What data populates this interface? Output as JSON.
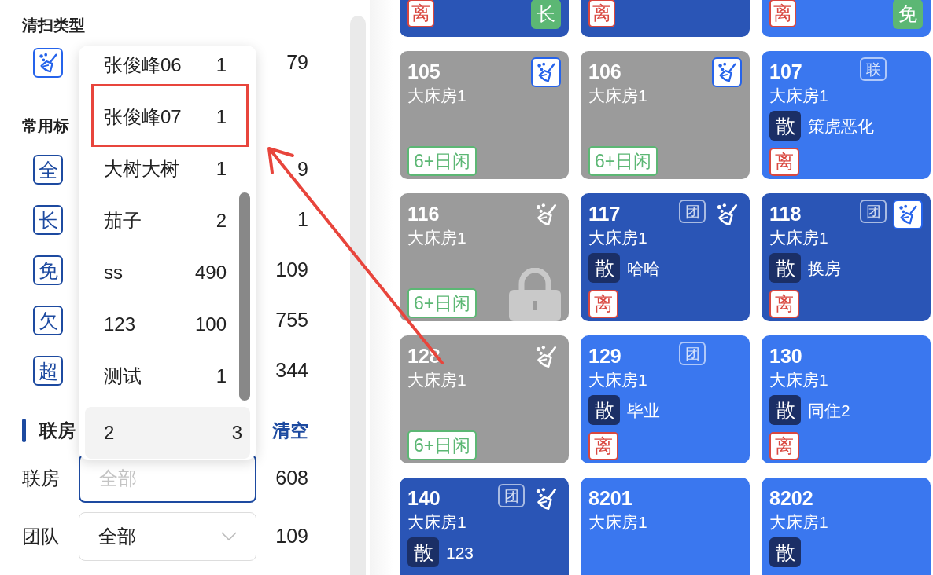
{
  "clean_type": {
    "title": "清扫类型",
    "rows": [
      {
        "count": "79"
      }
    ]
  },
  "common_tags": {
    "title": "常用标",
    "rows": [
      {
        "badge": "全",
        "count": "9"
      },
      {
        "badge": "长",
        "count": "1"
      },
      {
        "badge": "免",
        "count": "109"
      },
      {
        "badge": "欠",
        "count": "755"
      },
      {
        "badge": "超",
        "count": "344"
      }
    ]
  },
  "linked": {
    "title": "联房",
    "clear": "清空",
    "fields": [
      {
        "kind": "input",
        "label": "联房",
        "placeholder": "全部",
        "focused": true,
        "count": "608"
      },
      {
        "kind": "select",
        "label": "团队",
        "value": "全部",
        "focused": false,
        "count": "109"
      }
    ]
  },
  "dropdown": {
    "items": [
      {
        "name": "张俊峰06",
        "count": "1",
        "selected": false,
        "annotated": false
      },
      {
        "name": "张俊峰07",
        "count": "1",
        "selected": false,
        "annotated": true
      },
      {
        "name": "大树大树",
        "count": "1",
        "selected": false,
        "annotated": false
      },
      {
        "name": "茄子",
        "count": "2",
        "selected": false,
        "annotated": false
      },
      {
        "name": "ss",
        "count": "490",
        "selected": false,
        "annotated": false
      },
      {
        "name": "123",
        "count": "100",
        "selected": false,
        "annotated": false
      },
      {
        "name": "测试",
        "count": "1",
        "selected": false,
        "annotated": false
      },
      {
        "name": "2",
        "count": "3",
        "selected": true,
        "annotated": false
      }
    ]
  },
  "rooms": [
    {
      "kind": "partial",
      "color": "#2a55b6",
      "leave": "离",
      "corner": "长"
    },
    {
      "kind": "partial",
      "color": "#2a55b6",
      "leave": "离"
    },
    {
      "kind": "partial",
      "color": "#3a77ef",
      "leave": "离",
      "corner": "免"
    },
    {
      "kind": "full",
      "number": "105",
      "type": "大床房1",
      "color": "#9b9b9b",
      "needs_cleaning": true,
      "clean_boxed": true,
      "idle": "6+日闲",
      "locked": false
    },
    {
      "kind": "full",
      "number": "106",
      "type": "大床房1",
      "color": "#9b9b9b",
      "needs_cleaning": true,
      "clean_boxed": true,
      "idle": "6+日闲",
      "locked": false
    },
    {
      "kind": "full",
      "number": "107",
      "type": "大床房1",
      "color": "#3a77ef",
      "tag": "联",
      "needs_cleaning": false,
      "guest": {
        "badge": "散",
        "name": "策虎恶化"
      },
      "leave": "离",
      "locked": false
    },
    {
      "kind": "full",
      "number": "116",
      "type": "大床房1",
      "color": "#9b9b9b",
      "needs_cleaning": true,
      "clean_boxed": false,
      "idle": "6+日闲",
      "locked": true
    },
    {
      "kind": "full",
      "number": "117",
      "type": "大床房1",
      "color": "#2a55b6",
      "tag": "团",
      "needs_cleaning": true,
      "clean_boxed": false,
      "guest": {
        "badge": "散",
        "name": "哈哈"
      },
      "leave": "离",
      "locked": false
    },
    {
      "kind": "full",
      "number": "118",
      "type": "大床房1",
      "color": "#2a55b6",
      "tag": "团",
      "needs_cleaning": true,
      "clean_boxed": true,
      "guest": {
        "badge": "散",
        "name": "换房"
      },
      "leave": "离",
      "locked": false
    },
    {
      "kind": "full",
      "number": "128",
      "type": "大床房1",
      "color": "#9b9b9b",
      "needs_cleaning": true,
      "clean_boxed": false,
      "idle": "6+日闲",
      "locked": false
    },
    {
      "kind": "full",
      "number": "129",
      "type": "大床房1",
      "color": "#3a77ef",
      "tag": "团",
      "needs_cleaning": false,
      "guest": {
        "badge": "散",
        "name": "毕业"
      },
      "leave": "离",
      "locked": false
    },
    {
      "kind": "full",
      "number": "130",
      "type": "大床房1",
      "color": "#3a77ef",
      "needs_cleaning": false,
      "guest": {
        "badge": "散",
        "name": "同住2"
      },
      "leave": "离",
      "locked": false
    },
    {
      "kind": "full",
      "number": "140",
      "type": "大床房1",
      "color": "#2a55b6",
      "tag": "团",
      "needs_cleaning": true,
      "clean_boxed": false,
      "guest": {
        "badge": "散",
        "name": "123"
      },
      "locked": false
    },
    {
      "kind": "full",
      "number": "8201",
      "type": "大床房1",
      "color": "#3a77ef",
      "needs_cleaning": false,
      "locked": false
    },
    {
      "kind": "full",
      "number": "8202",
      "type": "大床房1",
      "color": "#3a77ef",
      "needs_cleaning": false,
      "guest": {
        "badge": "散"
      },
      "locked": false
    }
  ]
}
